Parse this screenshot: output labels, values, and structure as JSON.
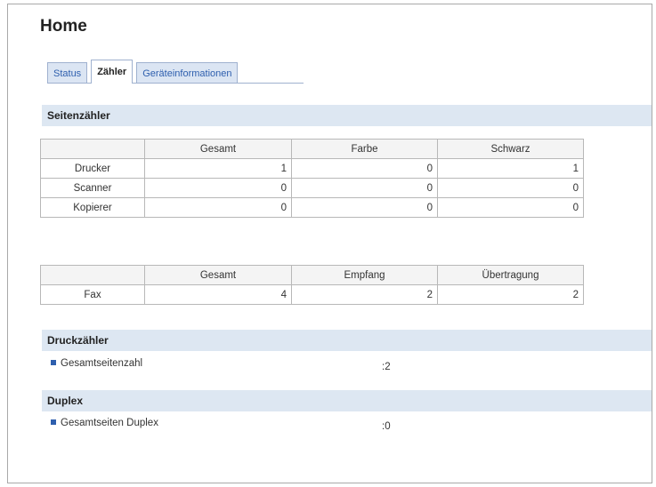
{
  "page": {
    "title": "Home"
  },
  "tabs": [
    {
      "label": "Status",
      "active": false
    },
    {
      "label": "Zähler",
      "active": true
    },
    {
      "label": "Geräteinformationen",
      "active": false
    }
  ],
  "sections": {
    "page_counter": "Seitenzähler",
    "print_counter": "Druckzähler",
    "duplex": "Duplex"
  },
  "page_counter_table": {
    "headers": [
      "",
      "Gesamt",
      "Farbe",
      "Schwarz"
    ],
    "rows": [
      {
        "label": "Drucker",
        "values": [
          "1",
          "0",
          "1"
        ]
      },
      {
        "label": "Scanner",
        "values": [
          "0",
          "0",
          "0"
        ]
      },
      {
        "label": "Kopierer",
        "values": [
          "0",
          "0",
          "0"
        ]
      }
    ]
  },
  "fax_table": {
    "headers": [
      "",
      "Gesamt",
      "Empfang",
      "Übertragung"
    ],
    "rows": [
      {
        "label": "Fax",
        "values": [
          "4",
          "2",
          "2"
        ]
      }
    ]
  },
  "print_counter": {
    "label": "Gesamtseitenzahl",
    "value": ":2"
  },
  "duplex": {
    "label": "Gesamtseiten Duplex",
    "value": ":0"
  },
  "colors": {
    "accent": "#2e5fae",
    "section_bg": "#dde7f2",
    "tab_bg": "#dbe5f3"
  }
}
